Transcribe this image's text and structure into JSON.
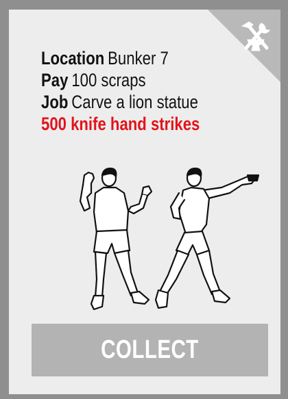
{
  "job_card": {
    "location_label": "Location",
    "location_value": "Bunker 7",
    "pay_label": "Pay",
    "pay_value": "100 scraps",
    "job_label": "Job",
    "job_value": "Carve a lion statue",
    "task": "500 knife hand strikes",
    "collect_label": "COLLECT",
    "corner_icon": "hammer-wrench-icon",
    "illustration": "knife-hand-strike-figure"
  },
  "colors": {
    "frame": "#8f8f8f",
    "card": "#ededed",
    "corner": "#b9b9b9",
    "task_red": "#e3131b",
    "button": "#b3b3b3",
    "button_text": "#ffffff"
  }
}
